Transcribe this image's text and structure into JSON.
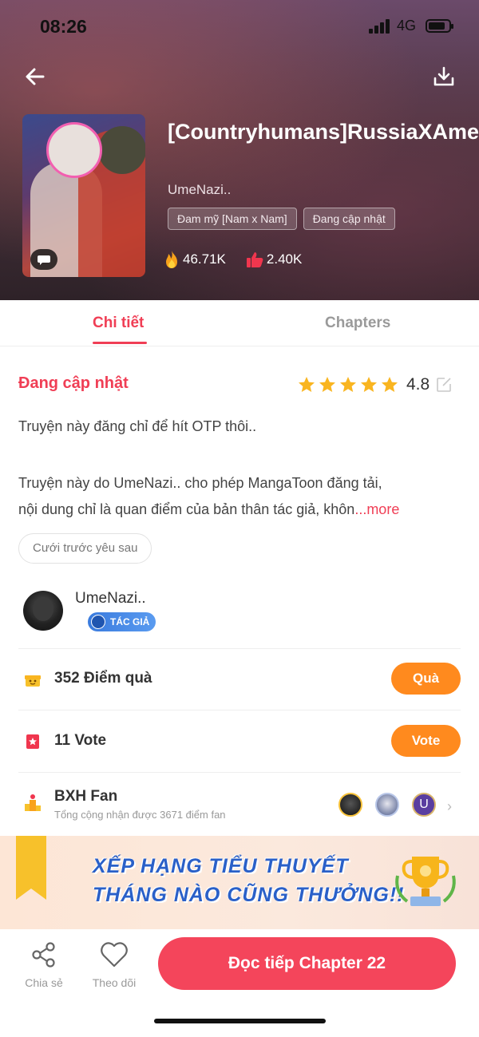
{
  "status_bar": {
    "time": "08:26",
    "network": "4G"
  },
  "book": {
    "title": "[Countryhumans]RussiaXAmericaXChina",
    "author": "UmeNazi..",
    "tags": [
      "Đam mỹ [Nam x Nam]",
      "Đang cập nhật"
    ],
    "views": "46.71K",
    "likes": "2.40K"
  },
  "tabs": {
    "detail": "Chi tiết",
    "chapters": "Chapters"
  },
  "detail": {
    "status": "Đang cập nhật",
    "rating": "4.8",
    "stars": 5,
    "desc_line1": "Truyện này đăng chỉ để hít OTP thôi..",
    "desc_line2": "Truyện này do UmeNazi.. cho phép MangaToon đăng tải,",
    "desc_line3": "nội dung chỉ là quan điểm của bản thân tác giả, khôn",
    "more": "...more",
    "chip": "Cưới trước yêu sau"
  },
  "author_card": {
    "name": "UmeNazi..",
    "badge": "TÁC GIẢ"
  },
  "gift": {
    "label": "352 Điểm quà",
    "button": "Quà"
  },
  "vote": {
    "label": "11 Vote",
    "button": "Vote"
  },
  "fan": {
    "title": "BXH Fan",
    "subtitle": "Tổng cộng nhận được 3671 điểm fan",
    "third_avatar_letter": "U"
  },
  "banner": {
    "line1": "XẾP HẠNG TIỂU THUYẾT",
    "line2": "THÁNG NÀO CŨNG THƯỞNG!!"
  },
  "bottom": {
    "share": "Chia sẻ",
    "follow": "Theo dõi",
    "read": "Đọc tiếp Chapter 22"
  },
  "colors": {
    "accent": "#f03e55",
    "orange": "#ff8a1e",
    "read_button": "#f4455b",
    "banner_text": "#2a60c8"
  }
}
